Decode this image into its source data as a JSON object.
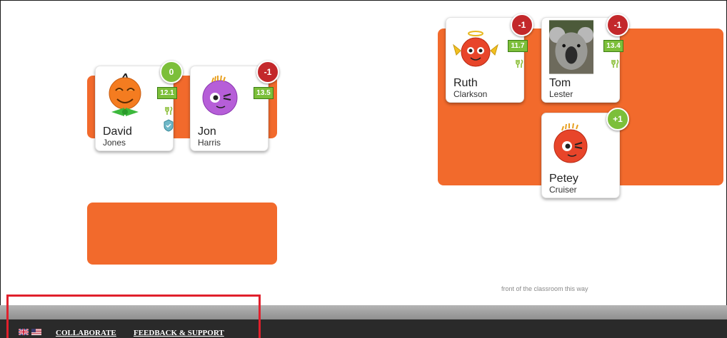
{
  "colors": {
    "table": "#f26a2c",
    "negative_badge": "#c3282b",
    "positive_badge": "#7cbf3a",
    "score_badge": "#7cbf3a",
    "footer": "#2a2a2a",
    "highlight": "#e0202c"
  },
  "students": [
    {
      "first": "David",
      "last": "Jones",
      "points": "0",
      "score": "12.1",
      "avatar": "orange-monster-bowtie-avatar",
      "has_meal_icon": true,
      "has_shield_icon": true
    },
    {
      "first": "Jon",
      "last": "Harris",
      "points": "-1",
      "score": "13.5",
      "avatar": "purple-monster-avatar",
      "has_meal_icon": false,
      "has_shield_icon": false
    },
    {
      "first": "Ruth",
      "last": "Clarkson",
      "points": "-1",
      "score": "11.7",
      "avatar": "red-angel-monster-avatar",
      "has_meal_icon": true,
      "has_shield_icon": false
    },
    {
      "first": "Tom",
      "last": "Lester",
      "points": "-1",
      "score": "13.4",
      "avatar": "koala-photo-avatar",
      "has_meal_icon": true,
      "has_shield_icon": false
    },
    {
      "first": "Petey",
      "last": "Cruiser",
      "points": "+1",
      "score": "",
      "avatar": "red-monster-avatar",
      "has_meal_icon": false,
      "has_shield_icon": false
    }
  ],
  "classroom": {
    "front_label": "front of the classroom this way"
  },
  "footer": {
    "flags": [
      "uk-flag-icon",
      "us-flag-icon"
    ],
    "collaborate": "COLLABORATE",
    "feedback": "FEEDBACK & SUPPORT"
  }
}
